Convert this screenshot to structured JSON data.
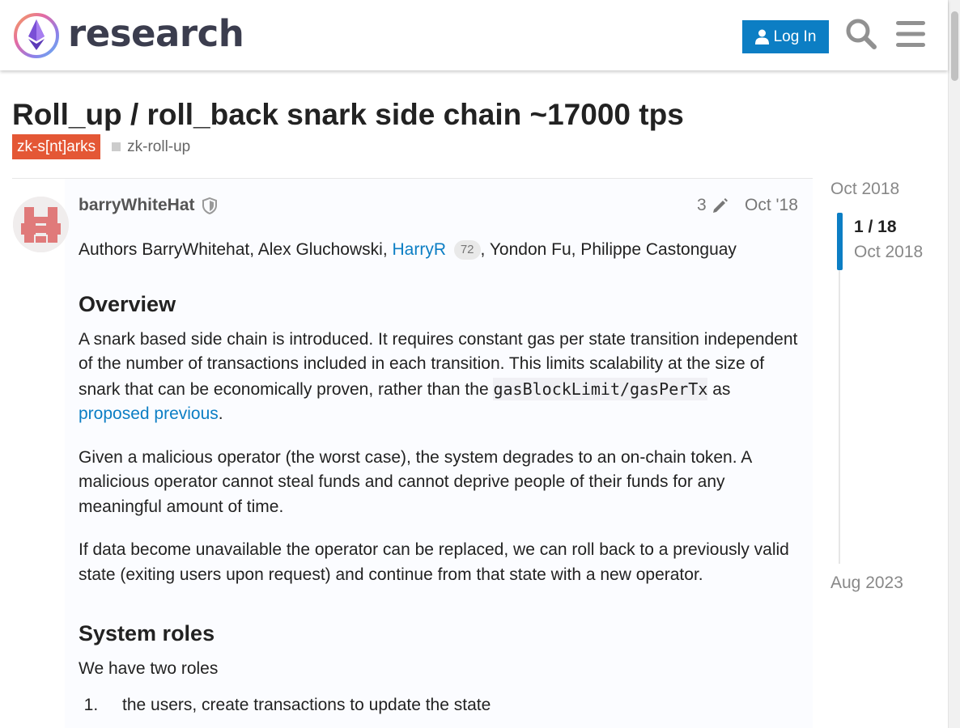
{
  "header": {
    "logo_text": "research",
    "login_label": "Log In",
    "search_icon": "search-icon",
    "menu_icon": "hamburger-menu-icon"
  },
  "topic": {
    "title": "Roll_up / roll_back snark side chain ~17000 tps",
    "category": "zk-s[nt]arks",
    "category_color": "#e45735",
    "tag": "zk-roll-up"
  },
  "post": {
    "username": "barryWhiteHat",
    "edit_count": "3",
    "date": "Oct '18",
    "authors_prefix": "Authors BarryWhitehat, Alex Gluchowski, ",
    "authors_link": "HarryR",
    "authors_badge": "72",
    "authors_suffix": ", Yondon Fu, Philippe Castonguay",
    "overview_heading": "Overview",
    "p1_text": "A snark based side chain is introduced. It requires constant gas per state transition independent of the number of transactions included in each transition. This limits scalability at the size of snark that can be economically proven, rather than the ",
    "p1_code": "gasBlockLimit/gasPerTx",
    "p1_mid": " as ",
    "p1_link": "proposed previous",
    "p1_end": ".",
    "p2": "Given a malicious operator (the worst case), the system degrades to an on-chain token. A malicious operator cannot steal funds and cannot deprive people of their funds for any meaningful amount of time.",
    "p3": "If data become unavailable the operator can be replaced, we can roll back to a previously valid state (exiting users upon request) and continue from that state with a new operator.",
    "roles_heading": "System roles",
    "p4": "We have two roles",
    "list_item_1": "the users, create transactions to update the state"
  },
  "timeline": {
    "start": "Oct 2018",
    "position": "1 / 18",
    "position_date": "Oct 2018",
    "end": "Aug 2023"
  },
  "colors": {
    "accent": "#0c7ec4",
    "link": "#0c7ec4"
  }
}
